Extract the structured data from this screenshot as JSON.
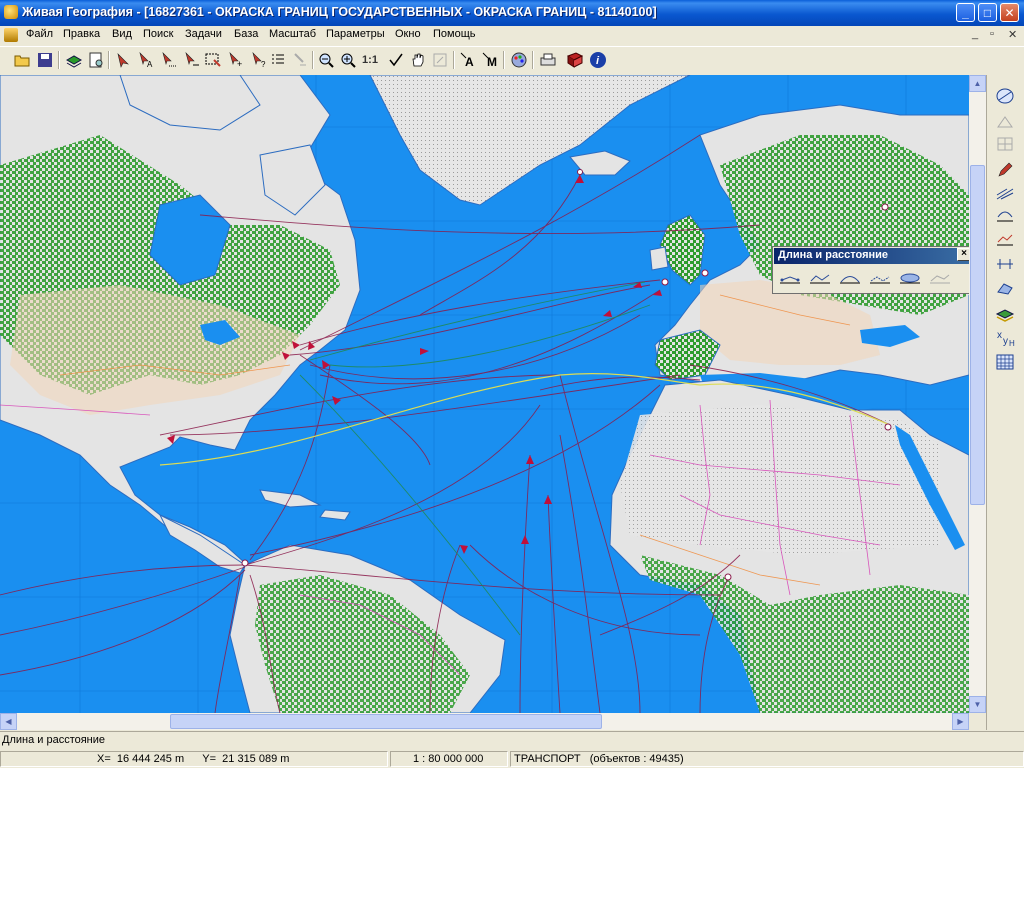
{
  "window": {
    "title": "Живая География - [16827361 - ОКРАСКА ГРАНИЦ ГОСУДАРСТВЕННЫХ - ОКРАСКА ГРАНИЦ - 81140100]",
    "minimize": "_",
    "maximize": "□",
    "close": "✕"
  },
  "menu": {
    "items": [
      "Файл",
      "Правка",
      "Вид",
      "Поиск",
      "Задачи",
      "База",
      "Масштаб",
      "Параметры",
      "Окно",
      "Помощь"
    ],
    "mdi_controls": [
      "_",
      "▫",
      "✕"
    ]
  },
  "toolbar": {
    "scale_label": "1:1",
    "text_tool_1": "A",
    "text_tool_2": "M"
  },
  "floating_panel": {
    "title": "Длина и расстояние"
  },
  "status": {
    "hint": "Длина и расстояние",
    "coords": "X=  16 444 245 m      Y=  21 315 089 m",
    "scale": "1 : 80 000 000",
    "layer": "ТРАНСПОРТ   (объектов : 49435)"
  },
  "colors": {
    "ocean": "#1a8ff0",
    "land": "#e4e4e4",
    "forest": "#2f9c2f",
    "route": "#8a1a4a",
    "titlebar": "#0a5fd8"
  }
}
